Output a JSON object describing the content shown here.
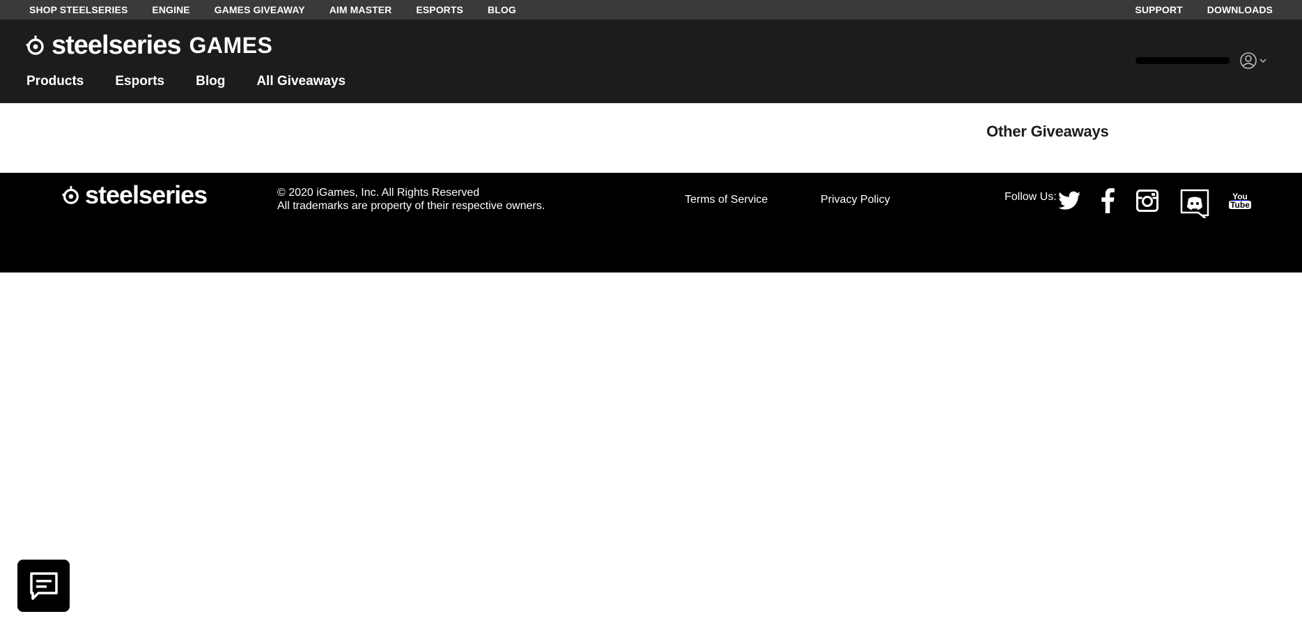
{
  "topbar": {
    "left": [
      {
        "label": "SHOP STEELSERIES"
      },
      {
        "label": "ENGINE"
      },
      {
        "label": "GAMES GIVEAWAY"
      },
      {
        "label": "AIM MASTER"
      },
      {
        "label": "ESPORTS"
      },
      {
        "label": "BLOG"
      }
    ],
    "right": [
      {
        "label": "SUPPORT"
      },
      {
        "label": "DOWNLOADS"
      }
    ]
  },
  "header": {
    "brand": "steelseries",
    "brand_suffix": "GAMES",
    "nav": [
      {
        "label": "Products"
      },
      {
        "label": "Esports"
      },
      {
        "label": "Blog"
      },
      {
        "label": "All Giveaways"
      }
    ],
    "user_icon": "user-circle-icon"
  },
  "content": {
    "other_title": "Other Giveaways"
  },
  "footer": {
    "brand": "steelseries",
    "copyright": "© 2020 iGames, Inc. All Rights Reserved",
    "trademarks": "All trademarks are property of their respective owners.",
    "links": {
      "terms": "Terms of Service",
      "privacy": "Privacy Policy"
    },
    "follow_label": "Follow Us:",
    "social": [
      "twitter-icon",
      "facebook-icon",
      "instagram-icon",
      "discord-icon",
      "youtube-icon"
    ],
    "youtube_top": "You",
    "youtube_bottom": "Tube"
  },
  "chat": {
    "icon": "chat-icon"
  },
  "colors": {
    "topbar_bg": "#3a3a3a",
    "header_bg": "#1c1c1c",
    "footer_bg": "#000000",
    "text_light": "#ffffff"
  }
}
